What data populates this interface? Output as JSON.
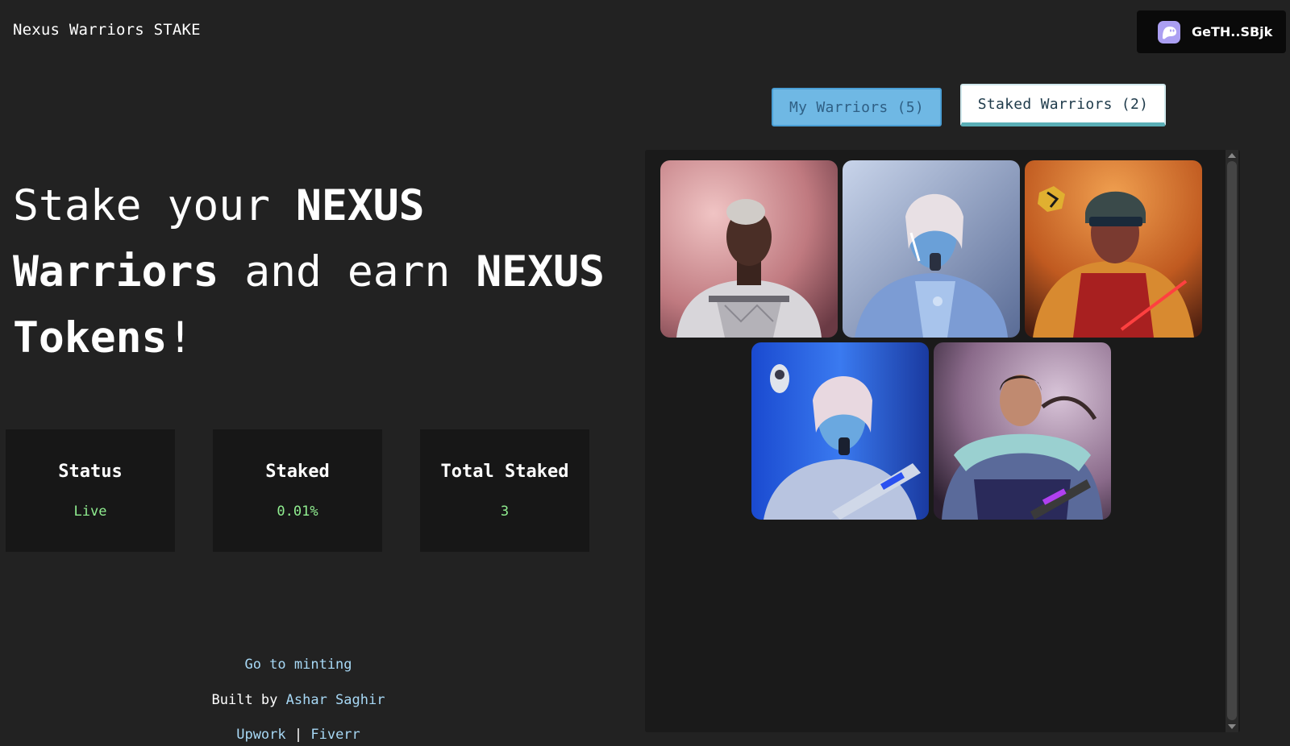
{
  "header": {
    "brand": "Nexus Warriors STAKE",
    "wallet_label": "GeTH..SBjk",
    "wallet_icon": "ghost-icon"
  },
  "tabs": [
    {
      "label": "My Warriors (5)",
      "active": false
    },
    {
      "label": "Staked Warriors (2)",
      "active": true
    }
  ],
  "headline": {
    "w1": "Stake your ",
    "b1": "NEXUS",
    "b2": "Warriors",
    "w2": " and earn ",
    "b3": "NEXUS",
    "b4": "Tokens",
    "w3": "!"
  },
  "stats": [
    {
      "title": "Status",
      "value": "Live"
    },
    {
      "title": "Staked",
      "value": "0.01%"
    },
    {
      "title": "Total Staked",
      "value": "3"
    }
  ],
  "footer": {
    "mint_link": "Go to minting",
    "built_by_prefix": "Built by ",
    "author": "Ashar Saghir",
    "upwork": "Upwork",
    "separator": " | ",
    "fiverr": "Fiverr"
  },
  "colors": {
    "background": "#222222",
    "accent_green": "#90ee90",
    "link_blue": "#a7d8f5",
    "tab_active_bg": "#6fb8e4"
  },
  "warriors": [
    {
      "name": "warrior-1"
    },
    {
      "name": "warrior-2"
    },
    {
      "name": "warrior-3"
    },
    {
      "name": "warrior-4"
    },
    {
      "name": "warrior-5"
    }
  ]
}
